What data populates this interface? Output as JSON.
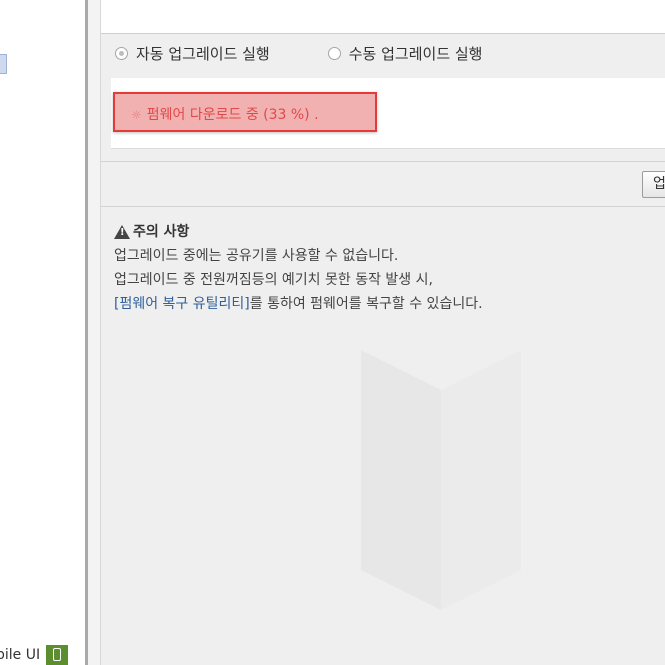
{
  "left": {
    "mobile_label": "bile UI",
    "mobile_icon": "mobile-phone-icon"
  },
  "upgrade": {
    "auto_label": "자동 업그레이드 실행",
    "manual_label": "수동 업그레이드 실행",
    "selected": "auto",
    "progress_spinner": "loading-spinner-icon",
    "progress_text": "펌웨어 다운로드 중 (33 %) .",
    "progress_percent": 33,
    "button_label": "업"
  },
  "notice": {
    "title": "주의 사항",
    "line1": "업그레이드 중에는 공유기를 사용할 수 없습니다.",
    "line2": "업그레이드 중 전원꺼짐등의 예기치 못한 동작 발생 시,",
    "line3_link": "[펌웨어 복구 유틸리티]",
    "line3_rest": "를 통하여 펌웨어를 복구할 수 있습니다.",
    "icon": "warning-triangle-icon"
  },
  "colors": {
    "highlight_border": "#e23b3b",
    "highlight_fill": "#f2b1b1",
    "link": "#2f5f9a",
    "mobile_icon_bg": "#5a8e2e"
  }
}
